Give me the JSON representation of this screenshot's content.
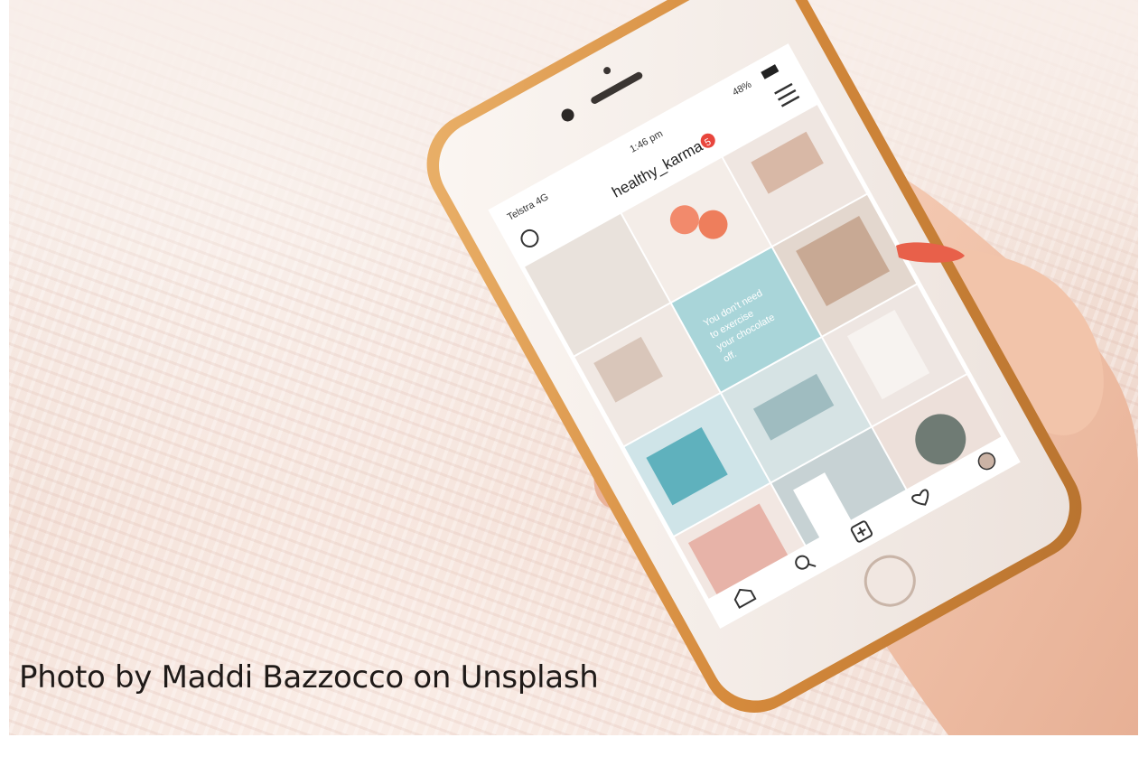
{
  "photo_credit": "Photo by Maddi Bazzocco on Unsplash",
  "phone_screen": {
    "status_bar": {
      "carrier": "Telstra",
      "network": "4G",
      "time": "1:46 pm",
      "battery": "48%"
    },
    "profile_header": {
      "username": "healthy_karma",
      "notification_count": "5"
    },
    "grid_quote": "You don't need to exercise your chocolate off.",
    "tab_bar_icons": [
      "home-icon",
      "search-icon",
      "add-post-icon",
      "heart-icon",
      "profile-icon"
    ]
  },
  "colors": {
    "phone_case": "#d9964a",
    "phone_body": "#f4ede8",
    "nail_polish": "#e8604a",
    "skin": "#f0c3ab",
    "quote_tile": "#a9d5d9",
    "badge": "#e8453c"
  }
}
